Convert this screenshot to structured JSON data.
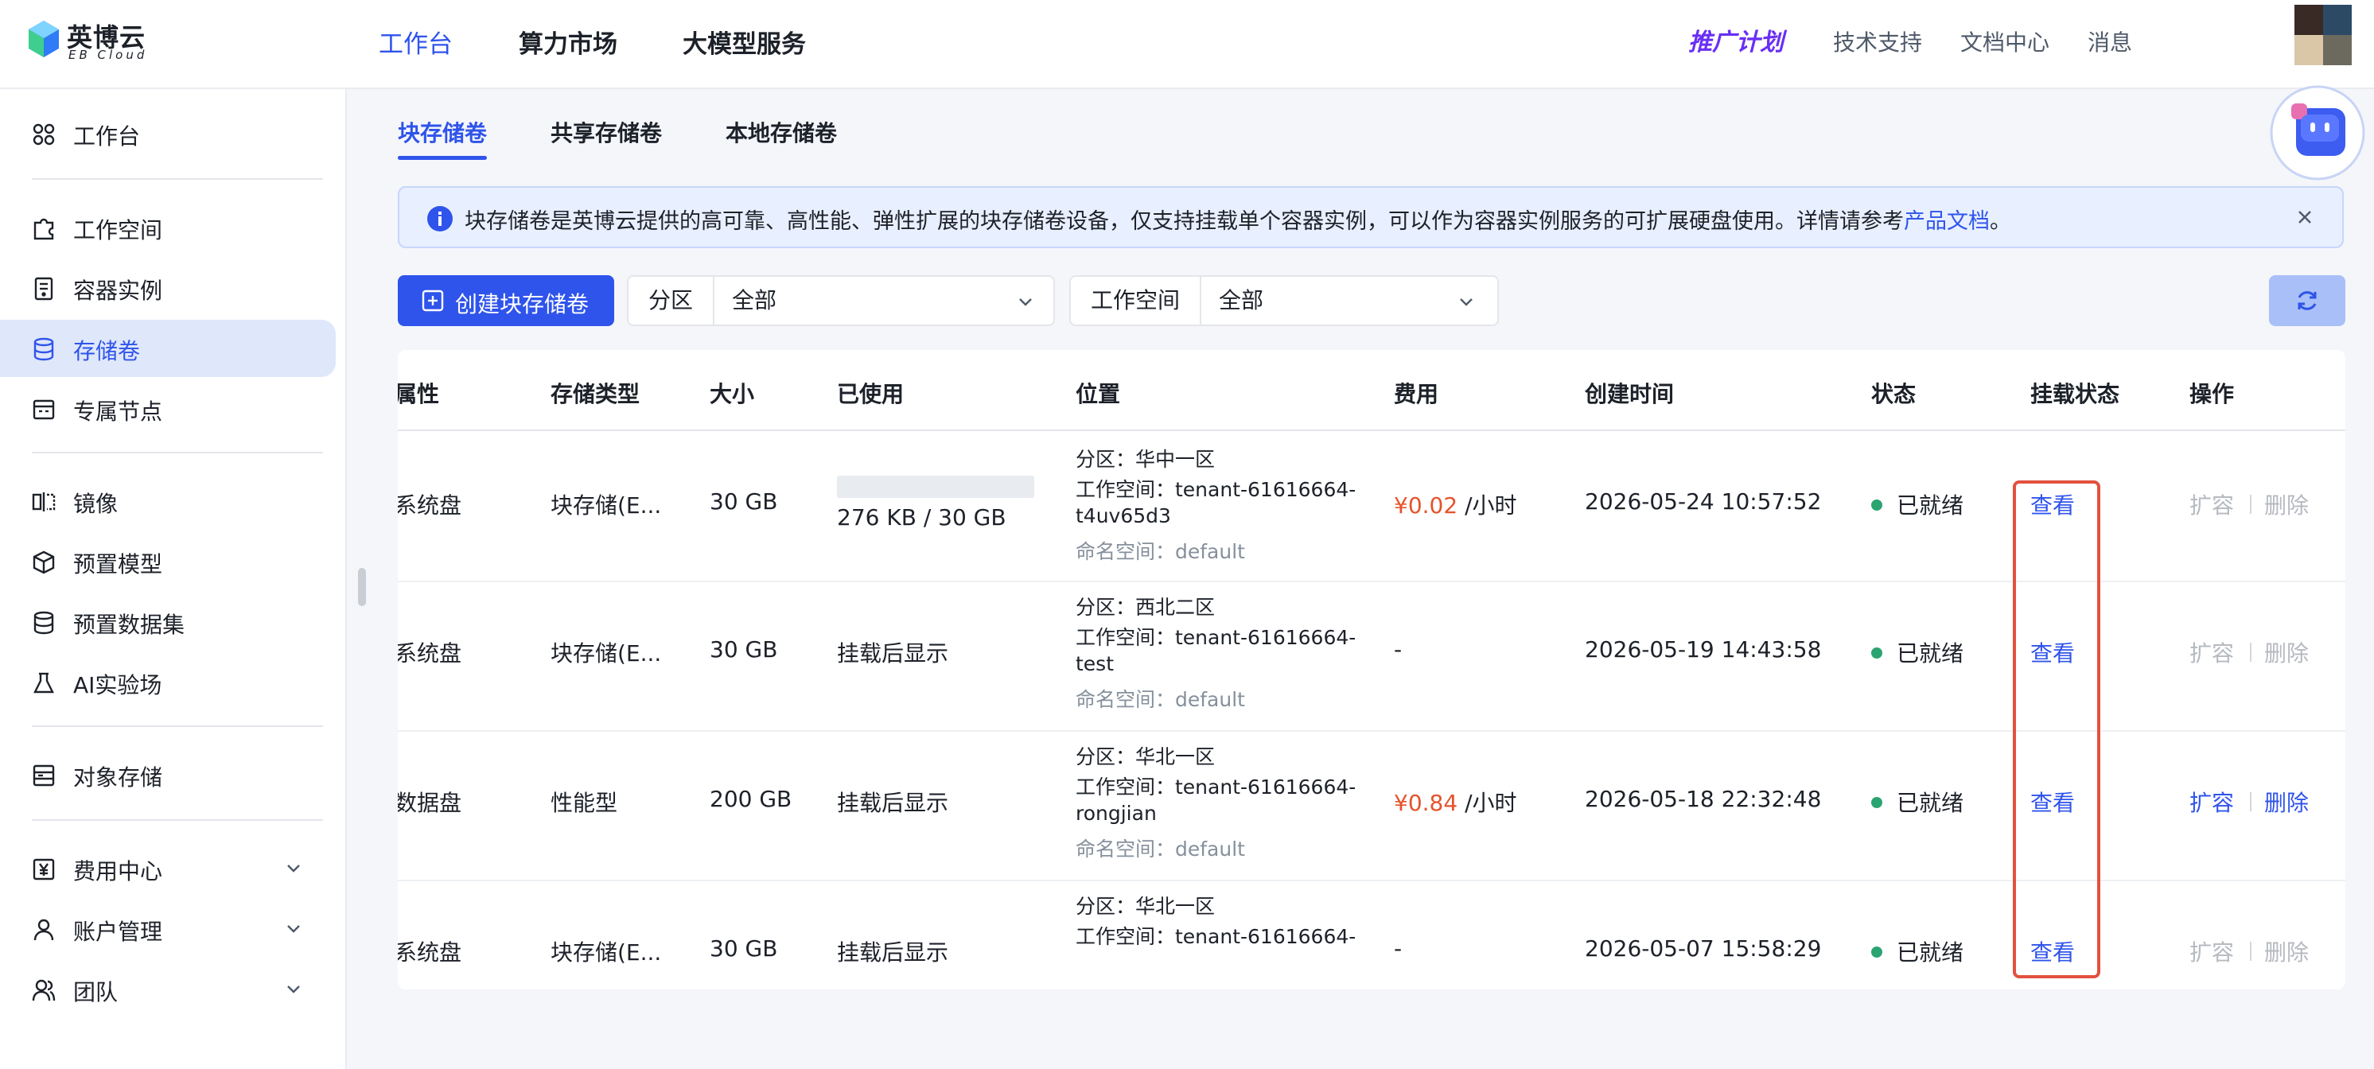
{
  "brand": {
    "name_cn": "英博云",
    "name_en": "EB Cloud"
  },
  "topnav": [
    {
      "label": "工作台",
      "active": true
    },
    {
      "label": "算力市场",
      "active": false
    },
    {
      "label": "大模型服务",
      "active": false
    }
  ],
  "top_right": {
    "promo": "推广计划",
    "support": "技术支持",
    "docs": "文档中心",
    "messages": "消息"
  },
  "sidebar": {
    "items": [
      {
        "label": "工作台",
        "icon": "grid-icon"
      },
      {
        "label": "工作空间",
        "icon": "puzzle-icon"
      },
      {
        "label": "容器实例",
        "icon": "container-icon"
      },
      {
        "label": "存储卷",
        "icon": "database-icon",
        "active": true
      },
      {
        "label": "专属节点",
        "icon": "node-icon"
      },
      {
        "label": "镜像",
        "icon": "mirror-icon"
      },
      {
        "label": "预置模型",
        "icon": "cube-icon"
      },
      {
        "label": "预置数据集",
        "icon": "dataset-icon"
      },
      {
        "label": "AI实验场",
        "icon": "flask-icon"
      },
      {
        "label": "对象存储",
        "icon": "object-storage-icon"
      },
      {
        "label": "费用中心",
        "icon": "yen-icon"
      },
      {
        "label": "账户管理",
        "icon": "user-icon"
      },
      {
        "label": "团队",
        "icon": "team-icon"
      }
    ]
  },
  "tabs": [
    {
      "label": "块存储卷",
      "active": true
    },
    {
      "label": "共享存储卷",
      "active": false
    },
    {
      "label": "本地存储卷",
      "active": false
    }
  ],
  "alert": {
    "text": "块存储卷是英博云提供的高可靠、高性能、弹性扩展的块存储卷设备，仅支持挂载单个容器实例，可以作为容器实例服务的可扩展硬盘使用。详情请参考",
    "link": "产品文档",
    "suffix": "。"
  },
  "toolbar": {
    "create_label": "创建块存储卷",
    "zone_label": "分区",
    "zone_value": "全部",
    "workspace_label": "工作空间",
    "workspace_value": "全部"
  },
  "table": {
    "headers": [
      "属性",
      "存储类型",
      "大小",
      "已使用",
      "位置",
      "费用",
      "创建时间",
      "状态",
      "挂载状态",
      "操作"
    ],
    "rows": [
      {
        "attr": "系统盘",
        "type": "块存储(E...",
        "size": "30 GB",
        "used": "276 KB / 30 GB",
        "used_fraction": 0.0,
        "zone": "分区：华中一区",
        "ws1": "工作空间：tenant-61616664-",
        "ws2": "t4uv65d3",
        "ns": "命名空间：default",
        "fee_amount": "¥0.02",
        "fee_unit": "/小时",
        "created": "2026-05-24 10:57:52",
        "status": "已就绪",
        "mount": "查看",
        "expand": "扩容",
        "delete": "删除",
        "ops_enabled": false
      },
      {
        "attr": "系统盘",
        "type": "块存储(E...",
        "size": "30 GB",
        "used": "挂载后显示",
        "zone": "分区：西北二区",
        "ws1": "工作空间：tenant-61616664-",
        "ws2": "test",
        "ns": "命名空间：default",
        "fee_amount": "",
        "fee_unit": "-",
        "created": "2026-05-19 14:43:58",
        "status": "已就绪",
        "mount": "查看",
        "expand": "扩容",
        "delete": "删除",
        "ops_enabled": false
      },
      {
        "attr": "数据盘",
        "type": "性能型",
        "size": "200 GB",
        "used": "挂载后显示",
        "zone": "分区：华北一区",
        "ws1": "工作空间：tenant-61616664-",
        "ws2": "rongjian",
        "ns": "命名空间：default",
        "fee_amount": "¥0.84",
        "fee_unit": "/小时",
        "created": "2026-05-18 22:32:48",
        "status": "已就绪",
        "mount": "查看",
        "expand": "扩容",
        "delete": "删除",
        "ops_enabled": true
      },
      {
        "attr": "系统盘",
        "type": "块存储(E...",
        "size": "30 GB",
        "used": "挂载后显示",
        "zone": "分区：华北一区",
        "ws1": "工作空间：tenant-61616664-",
        "ws2": "",
        "ns": "",
        "fee_amount": "",
        "fee_unit": "-",
        "created": "2026-05-07 15:58:29",
        "status": "已就绪",
        "mount": "查看",
        "expand": "扩容",
        "delete": "删除",
        "ops_enabled": false
      }
    ]
  },
  "colors": {
    "accent": "#2f54eb",
    "fee": "#e5532b",
    "status_ok": "#2ba471",
    "highlight": "#e2513f"
  }
}
